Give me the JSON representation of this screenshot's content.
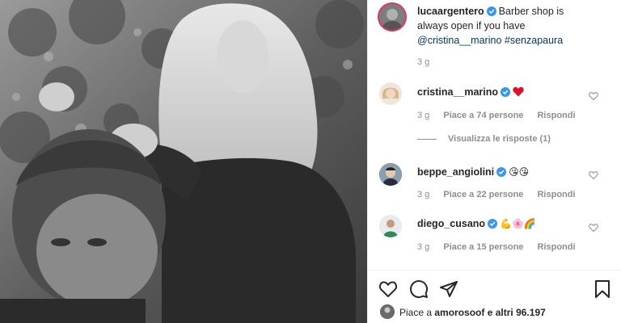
{
  "post": {
    "author": "lucaargentero",
    "caption_text": "Barber shop is always open if you have",
    "caption_mention": "@cristina__marino",
    "caption_hashtag": "#senzapaura",
    "time": "3 g"
  },
  "comments": [
    {
      "user": "cristina__marino",
      "emoji": "❤️",
      "time": "3 g",
      "likes": "Piace a 74 persone",
      "reply": "Rispondi"
    },
    {
      "user": "beppe_angiolini",
      "emoji": "😘😘",
      "time": "3 g",
      "likes": "Piace a 22 persone",
      "reply": "Rispondi"
    },
    {
      "user": "diego_cusano",
      "emoji": "💪🌸🌈",
      "time": "3 g",
      "likes": "Piace a 15 persone",
      "reply": "Rispondi"
    }
  ],
  "view_replies": "Visualizza le risposte (1)",
  "liked_by": {
    "prefix": "Piace a",
    "user": "amorosoof",
    "suffix": "e altri 96.197"
  },
  "colors": {
    "verified": "#3897f0",
    "link": "#00376b",
    "meta": "#8e8e8e",
    "heart_red": "#ed4956"
  }
}
